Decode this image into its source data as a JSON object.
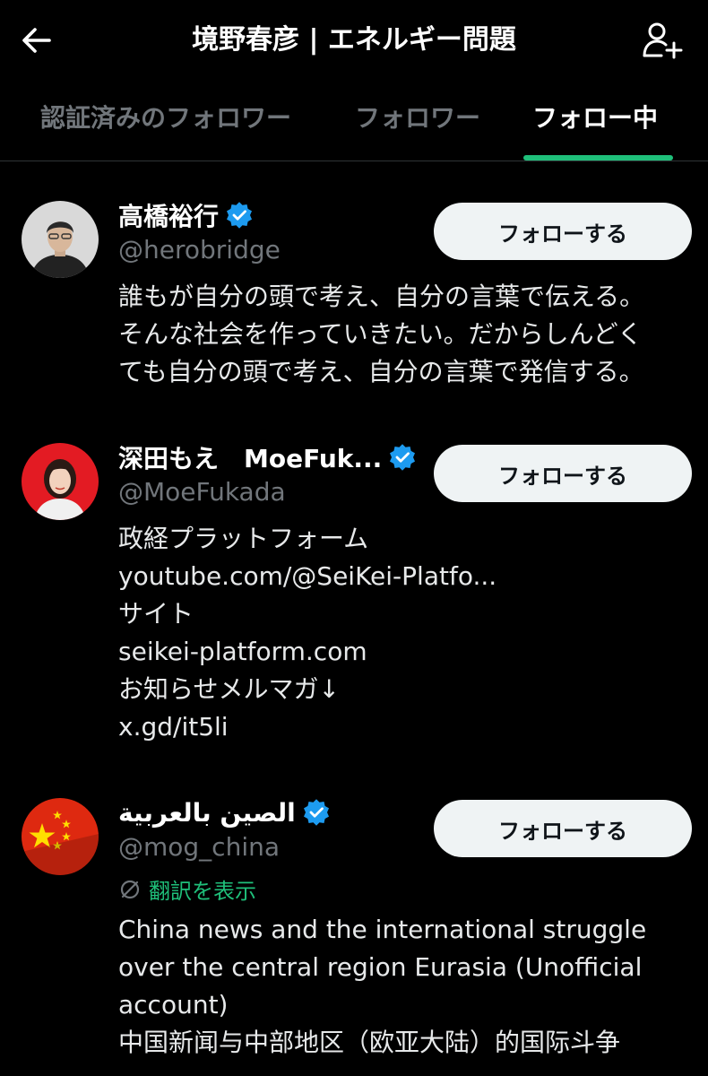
{
  "header": {
    "title": "境野春彦 | エネルギー問題",
    "back_icon": "arrow-left-icon",
    "add_user_icon": "person-add-icon"
  },
  "tabs": [
    {
      "label": "認証済みのフォロワー",
      "active": false
    },
    {
      "label": "フォロワー",
      "active": false
    },
    {
      "label": "フォロー中",
      "active": true
    }
  ],
  "colors": {
    "background": "#000000",
    "accent": "#1fbf7a",
    "verified": "#1d9bf0",
    "muted": "#71767b",
    "button_bg": "#eff3f4"
  },
  "users": [
    {
      "name": "高橋裕行",
      "handle": "@herobridge",
      "verified": true,
      "follow_label": "フォローする",
      "bio": [
        "誰もが自分の頭で考え、自分の言葉で伝える。",
        "そんな社会を作っていきたい。だからしんどく",
        "ても自分の頭で考え、自分の言葉で発信する。"
      ]
    },
    {
      "name": "深田もえ　MoeFuk...",
      "handle": "@MoeFukada",
      "verified": true,
      "follow_label": "フォローする",
      "bio": [
        "政経プラットフォーム",
        "youtube.com/@SeiKei-Platfo...",
        "サイト",
        "seikei-platform.com",
        "お知らせメルマガ↓",
        "x.gd/it5li"
      ]
    },
    {
      "name": "الصين بالعربية",
      "handle": "@mog_china",
      "verified": true,
      "follow_label": "フォローする",
      "translate_label": "翻訳を表示",
      "bio": [
        "China news and the international struggle",
        "over the central region Eurasia (Unofficial",
        "account)",
        "中国新闻与中部地区（欧亚大陆）的国际斗争"
      ]
    }
  ]
}
